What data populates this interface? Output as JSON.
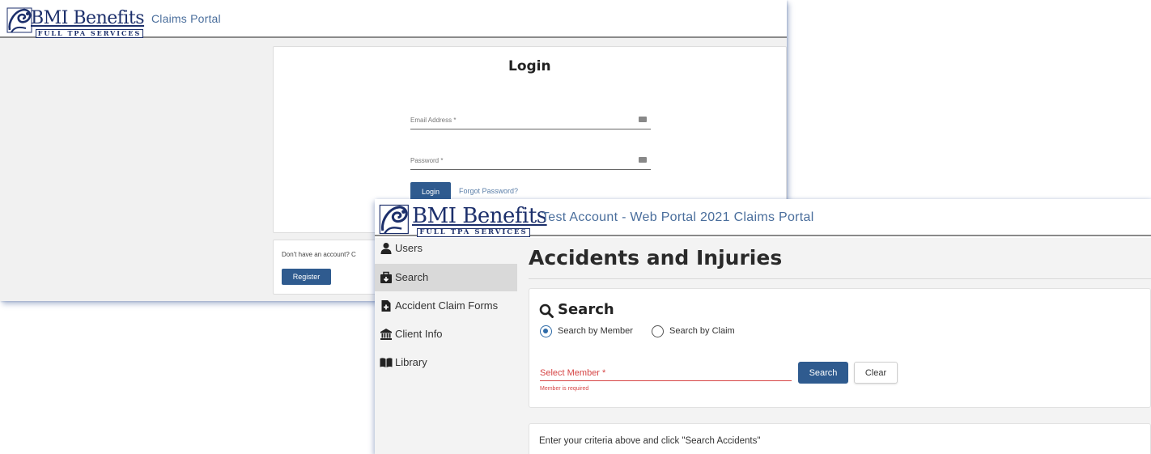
{
  "brand": {
    "name": "BMI Benefits",
    "tagline": "FULL TPA SERVICES",
    "navy": "#1c2f6b",
    "link_blue": "#4a6e9c",
    "button_blue": "#2f5b8f",
    "error_red": "#d64545"
  },
  "login_window": {
    "portal_title": "Claims Portal",
    "heading": "Login",
    "email_label": "Email Address *",
    "password_label": "Password *",
    "login_button": "Login",
    "forgot_link": "Forgot Password?",
    "register_prompt": "Don't have an account? C",
    "register_button": "Register"
  },
  "portal_window": {
    "portal_title": "Test Account - Web Portal 2021 Claims Portal",
    "sidebar": {
      "items": [
        {
          "label": "Users",
          "icon": "user-icon",
          "active": false
        },
        {
          "label": "Search",
          "icon": "search-box-icon",
          "active": true
        },
        {
          "label": "Accident Claim Forms",
          "icon": "file-plus-icon",
          "active": false
        },
        {
          "label": "Client Info",
          "icon": "bank-icon",
          "active": false
        },
        {
          "label": "Library",
          "icon": "book-icon",
          "active": false
        }
      ]
    },
    "page_title": "Accidents and Injuries",
    "search": {
      "heading": "Search",
      "radio_member": "Search by Member",
      "radio_claim": "Search by Claim",
      "selected_mode": "Search by Member",
      "member_label": "Select Member *",
      "member_error": "Member is required",
      "search_button": "Search",
      "clear_button": "Clear"
    },
    "results_message": "Enter your criteria above and click \"Search Accidents\""
  }
}
